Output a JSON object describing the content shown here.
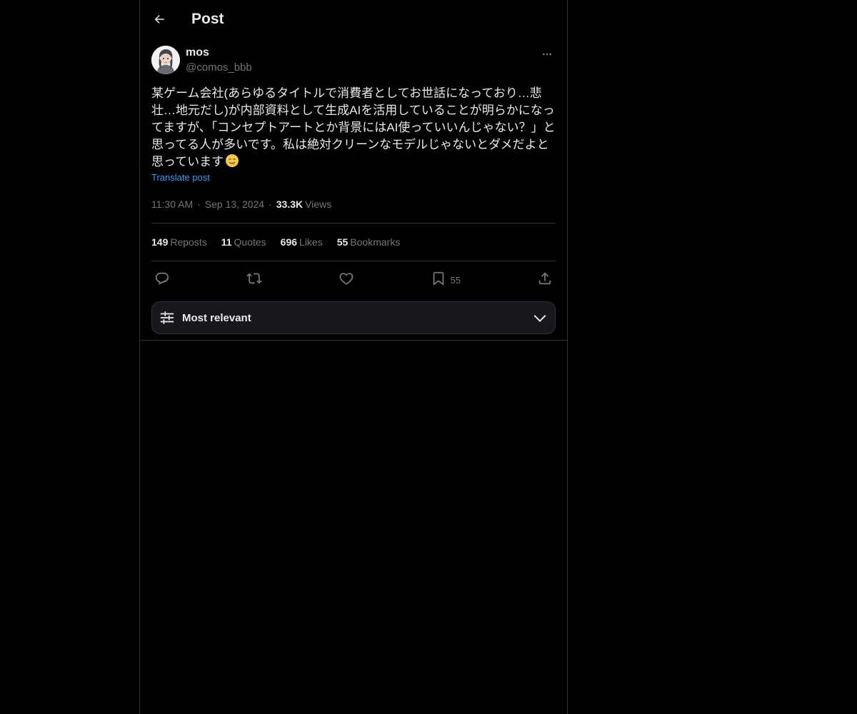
{
  "header": {
    "back_icon": "arrow-left-icon",
    "title": "Post"
  },
  "post": {
    "author": {
      "display_name": "mos",
      "handle": "@comos_bbb",
      "avatar_icon": "avatar-illustration"
    },
    "more_icon": "more-horizontal-icon",
    "text": "某ゲーム会社(あらゆるタイトルで消費者としてお世話になっており…悲壮…地元だし)が内部資料として生成AIを活用していることが明らかになってますが、「コンセプトアートとか背景にはAI使っていいんじゃない？」と思ってる人が多いです。私は絶対クリーンなモデルじゃないとダメだよと思っています",
    "emoji": "drooling-face-emoji",
    "translate_label": "Translate post",
    "time": "11:30 AM",
    "date": "Sep 13, 2024",
    "dot": "·",
    "views_count": "33.3K",
    "views_label": "Views"
  },
  "stats": {
    "reposts_count": "149",
    "reposts_label": "Reposts",
    "quotes_count": "11",
    "quotes_label": "Quotes",
    "likes_count": "696",
    "likes_label": "Likes",
    "bookmarks_count": "55",
    "bookmarks_label": "Bookmarks"
  },
  "actions": {
    "reply_icon": "reply-icon",
    "repost_icon": "repost-icon",
    "like_icon": "heart-icon",
    "bookmark_icon": "bookmark-icon",
    "bookmark_count": "55",
    "share_icon": "share-icon"
  },
  "sort": {
    "icon": "sliders-icon",
    "label": "Most relevant",
    "chevron_icon": "chevron-down-icon"
  },
  "colors": {
    "background": "#000000",
    "text_primary": "#e7e9ea",
    "text_secondary": "#71767b",
    "link": "#4a99e9",
    "border": "#2f3336"
  }
}
